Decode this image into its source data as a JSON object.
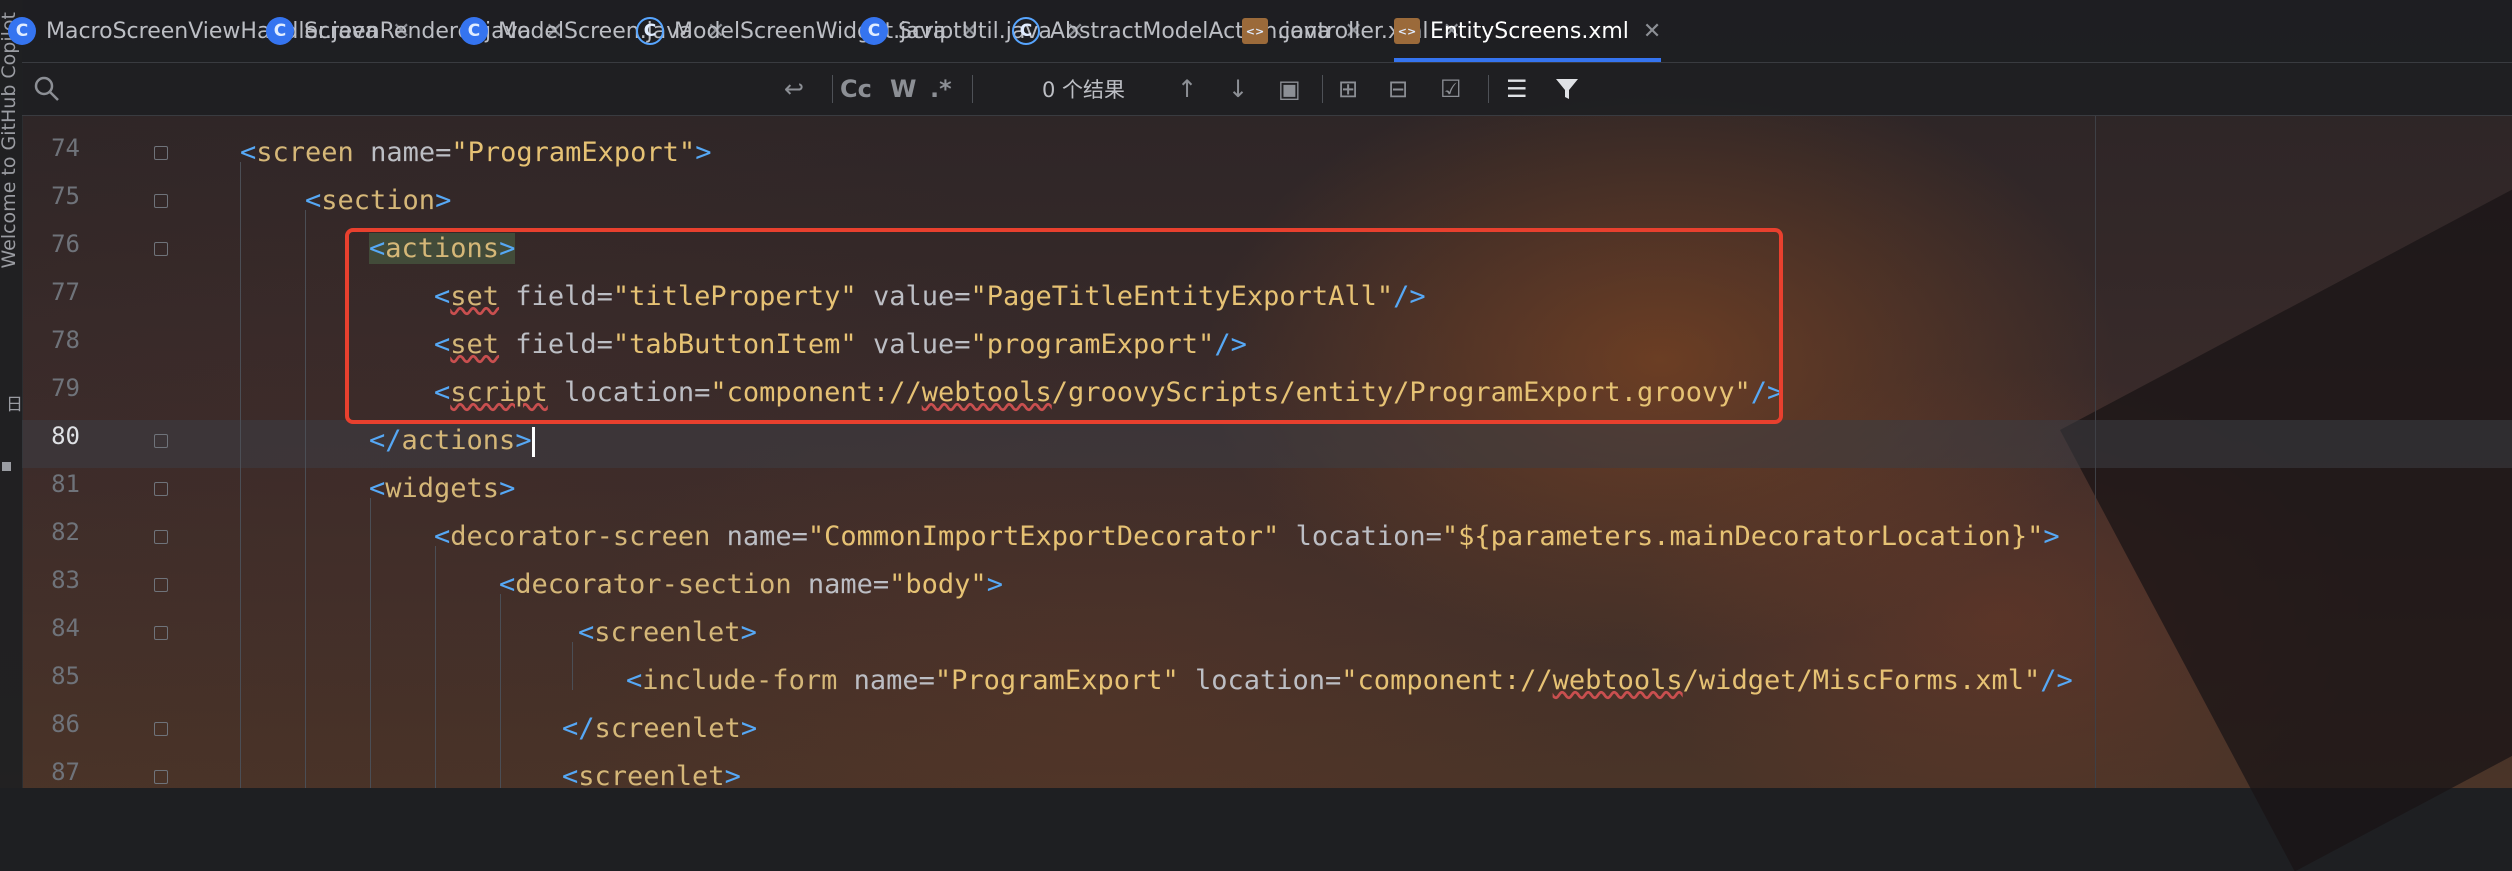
{
  "left_strip": {
    "vertical_label": "Welcome to GitHub Copilot",
    "side_label": "日"
  },
  "tabs": [
    {
      "label": "MacroScreenViewHandler.java",
      "icon": "java-class-icon"
    },
    {
      "label": "ScreenRenderer.java",
      "icon": "java-class-icon"
    },
    {
      "label": "ModelScreen.java",
      "icon": "java-class-icon"
    },
    {
      "label": "ModelScreenWidget.java",
      "icon": "java-class-icon"
    },
    {
      "label": "ScriptUtil.java",
      "icon": "java-class-icon"
    },
    {
      "label": "AbstractModelAction.java",
      "icon": "java-class-icon"
    },
    {
      "label": "controller.xml",
      "icon": "xml-file-icon"
    },
    {
      "label": "EntityScreens.xml",
      "icon": "xml-file-icon",
      "active": true
    }
  ],
  "find": {
    "results": "0 个结果",
    "case_label": "Cc",
    "word_label": "W",
    "regex_label": ".*"
  },
  "line_numbers": [
    "74",
    "75",
    "76",
    "77",
    "78",
    "79",
    "80",
    "81",
    "82",
    "83",
    "84",
    "85",
    "86",
    "87"
  ],
  "current_line": "80",
  "code": {
    "l74": {
      "open": "<",
      "tag": "screen",
      "attr1": " name=",
      "val1": "\"ProgramExport\"",
      "close": ">"
    },
    "l75": {
      "open": "<",
      "tag": "section",
      "close": ">"
    },
    "l76": {
      "open": "<",
      "tag": "actions",
      "close": ">"
    },
    "l77": {
      "open": "<",
      "tag": "set",
      "attr1": " field=",
      "val1": "\"titleProperty\"",
      "attr2": " value=",
      "val2": "\"PageTitleEntityExportAll\"",
      "close": "/>"
    },
    "l78": {
      "open": "<",
      "tag": "set",
      "attr1": " field=",
      "val1": "\"tabButtonItem\"",
      "attr2": " value=",
      "val2": "\"programExport\"",
      "close": "/>"
    },
    "l79": {
      "open": "<",
      "tag": "script",
      "attr1": " location=",
      "val1a": "\"component://",
      "val1b": "webtools",
      "val1c": "/groovyScripts/entity/ProgramExport.groovy\"",
      "close": "/>"
    },
    "l80": {
      "open": "</",
      "tag": "actions",
      "close": ">"
    },
    "l81": {
      "open": "<",
      "tag": "widgets",
      "close": ">"
    },
    "l82": {
      "open": "<",
      "tag": "decorator-screen",
      "attr1": " name=",
      "val1": "\"CommonImportExportDecorator\"",
      "attr2": " location=",
      "val2": "\"${parameters.mainDecoratorLocation}\"",
      "close": ">"
    },
    "l83": {
      "open": "<",
      "tag": "decorator-section",
      "attr1": " name=",
      "val1": "\"body\"",
      "close": ">"
    },
    "l84": {
      "open": "<",
      "tag": "screenlet",
      "close": ">"
    },
    "l85": {
      "open": "<",
      "tag": "include-form",
      "attr1": " name=",
      "val1": "\"ProgramExport\"",
      "attr2": " location=",
      "val2a": "\"component://",
      "val2b": "webtools",
      "val2c": "/widget/MiscForms.xml\"",
      "close": "/>"
    },
    "l86": {
      "open": "</",
      "tag": "screenlet",
      "close": ">"
    },
    "l87": {
      "open": "<",
      "tag": "screenlet",
      "close": ">"
    }
  },
  "colors": {
    "highlight_box": "#e8402e",
    "tag": "#d5b778",
    "string": "#6aab73",
    "accent": "#3574f0"
  }
}
